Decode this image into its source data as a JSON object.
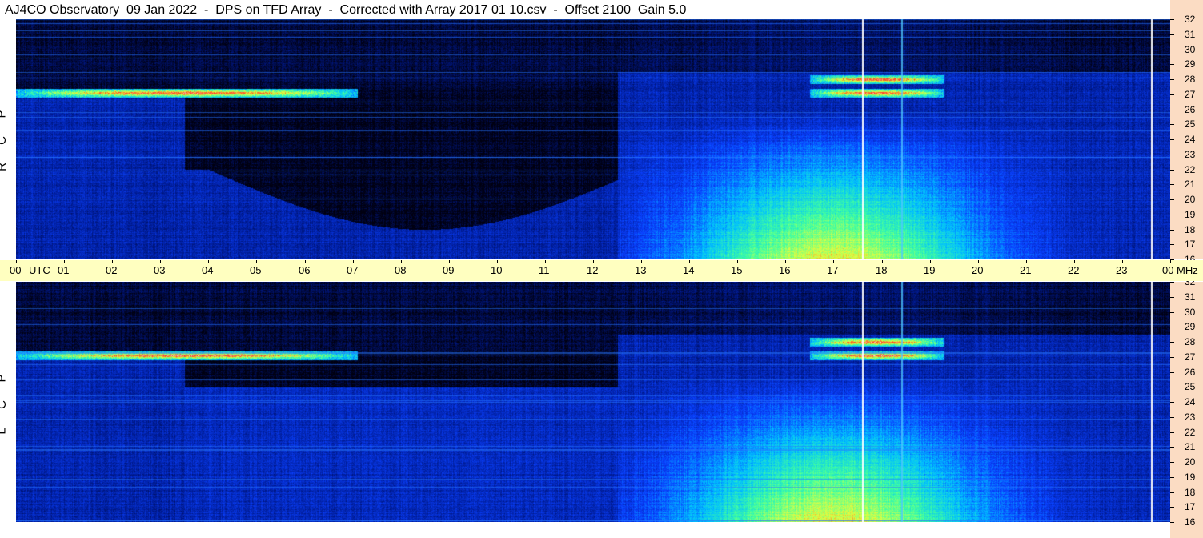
{
  "title": "AJ4CO Observatory  09 Jan 2022  -  DPS on TFD Array  -  Corrected with Array 2017 01 10.csv  -  Offset 2100  Gain 5.0",
  "panels": [
    {
      "polarization": "RCP",
      "side_letters": [
        "P",
        "C",
        "R"
      ]
    },
    {
      "polarization": "LCP",
      "side_letters": [
        "P",
        "C",
        "L"
      ]
    }
  ],
  "time_axis": {
    "labels": [
      "00",
      "01",
      "02",
      "03",
      "04",
      "05",
      "06",
      "07",
      "08",
      "09",
      "10",
      "11",
      "12",
      "13",
      "14",
      "15",
      "16",
      "17",
      "18",
      "19",
      "20",
      "21",
      "22",
      "23",
      "00"
    ],
    "unit_label": "UTC",
    "freq_unit_label": "MHz"
  },
  "colors": {
    "background": "#ffffff",
    "freq_axis_bg": "#fbdcc3",
    "time_axis_bg": "#ffffc0",
    "colormap": [
      "#000010",
      "#001a90",
      "#0a40ff",
      "#00c0ff",
      "#40ffa0",
      "#e0ff40",
      "#ff4020",
      "#ffffff"
    ]
  },
  "chart_data": {
    "type": "heatmap",
    "title": "AJ4CO Observatory  09 Jan 2022  -  DPS on TFD Array  -  Corrected with Array 2017 01 10.csv  -  Offset 2100  Gain 5.0",
    "xlabel": "UTC",
    "ylabel": "MHz",
    "x_range_hours": [
      0,
      24
    ],
    "y_range_mhz": [
      16,
      32
    ],
    "y_ticks_mhz": [
      16,
      17,
      18,
      19,
      20,
      21,
      22,
      23,
      24,
      25,
      26,
      27,
      28,
      29,
      30,
      31,
      32
    ],
    "x_tick_labels": [
      "00",
      "01",
      "02",
      "03",
      "04",
      "05",
      "06",
      "07",
      "08",
      "09",
      "10",
      "11",
      "12",
      "13",
      "14",
      "15",
      "16",
      "17",
      "18",
      "19",
      "20",
      "21",
      "22",
      "23",
      "00"
    ],
    "series": [
      {
        "name": "RCP"
      },
      {
        "name": "LCP"
      }
    ],
    "features": [
      {
        "type": "intense_band",
        "t_start": 0.0,
        "t_end": 7.1,
        "f_mhz": 27.1
      },
      {
        "type": "intense_band",
        "t_start": 16.5,
        "t_end": 19.3,
        "f_mhz": 28.0
      },
      {
        "type": "intense_band",
        "t_start": 16.5,
        "t_end": 19.3,
        "f_mhz": 27.1
      },
      {
        "type": "daytime_brightening",
        "t_start": 12.5,
        "t_end": 24.0,
        "peak_hour": 17.0
      },
      {
        "type": "vertical_line",
        "t_hour": 17.6
      },
      {
        "type": "vertical_line",
        "t_hour": 18.4
      },
      {
        "type": "vertical_line",
        "t_hour": 23.6
      }
    ]
  }
}
